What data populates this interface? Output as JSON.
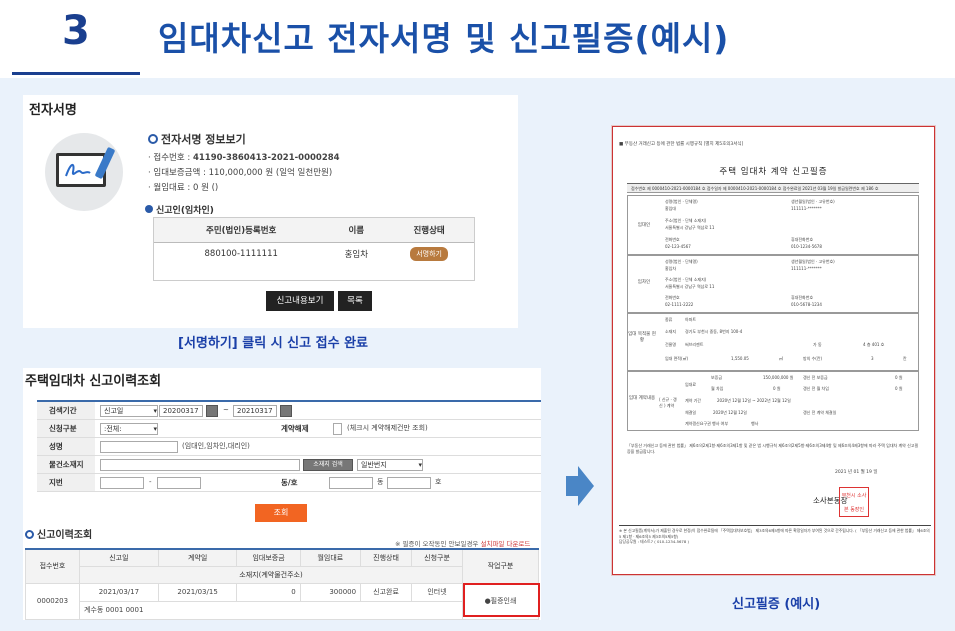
{
  "header": {
    "number": "3",
    "title": "임대차신고 전자서명 및 신고필증(예시)"
  },
  "sign_panel": {
    "title": "전자서명",
    "info_title": "전자서명 정보보기",
    "info_lines": [
      {
        "label": "· 접수번호 : ",
        "value": "41190-3860413-2021-0000284"
      },
      {
        "label": "· 임대보증금액 : ",
        "value": "110,000,000 원 (일억 일천만원)"
      },
      {
        "label": "· 월임대료 : ",
        "value": "0 원 ()"
      }
    ],
    "signer_title": "신고인(임차인)",
    "table": {
      "headers": [
        "주민(법인)등록번호",
        "이름",
        "진행상태"
      ],
      "row": {
        "id": "880100-1111111",
        "name": "홍임차",
        "status": "서명하기"
      }
    },
    "buttons": {
      "view": "신고내용보기",
      "list": "목록"
    },
    "caption": "[서명하기] 클릭 시 신고 접수 완료"
  },
  "history_panel": {
    "title": "주택임대차 신고이력조회",
    "form": {
      "period_label": "검색기간",
      "period_type": "신고일",
      "date_from": "20200317",
      "tilde": "~",
      "date_to": "20210317",
      "applicant_label": "신청구분",
      "applicant_value": ":전체:",
      "contract_label": "계약해제",
      "contract_check": "(체크시 계약해제건만 조회)",
      "name_label": "성명",
      "name_hint": "(임대인,임차인,대리인)",
      "address_label": "물건소재지",
      "address_btn": "소재지 검색",
      "address_type": "일반번지",
      "lot_label": "지번",
      "dash": "-",
      "dong_label": "동/호",
      "dong_unit": "동",
      "ho_unit": "호"
    },
    "search_button": "조회",
    "list_title": "신고이력조회",
    "note_prefix": "※ 필증이 오작동인 안보일경우 ",
    "note_link": "설치파일 다운로드",
    "table": {
      "headers": [
        "접수번호",
        "신고일",
        "계약일",
        "임대보증금",
        "월임대료",
        "진행상태",
        "신청구분",
        "작업구분"
      ],
      "subheader": "소재지(계약물건주소)",
      "row": {
        "receipt": "0000203",
        "report_date": "2021/03/17",
        "contract_date": "2021/03/15",
        "deposit": "0",
        "rent": "300000",
        "status": "신고완료",
        "type": "인터넷",
        "action": "필증인쇄",
        "address": "계수동 0001 0001"
      }
    }
  },
  "certificate": {
    "top_note": "■ 부동산 거래신고 등에 관한 법률 시행규칙 [별지 제5호의3서식]",
    "title": "주택 임대차 계약 신고필증",
    "bar": "접수번호  제 0000410-2021-0000184 호   접수일자  제 0000410-2021-0000184 호   접수완료일  2021년 03월 19일   발급일련번호  제 186 호",
    "lessor_label": "임대인",
    "lessee_label": "임차인",
    "property_label": "임대 목적물 현황",
    "contract_label": "임대 계약내용",
    "lessor": {
      "name_label": "성명(법인 · 단체명)",
      "name": "홍임대",
      "id_label": "생년월일(법인 · 고유번호)",
      "id": "111111-*******",
      "addr_label": "주소(법인 · 단체 소재지)",
      "addr": "서울특별시 강남구 역삼로 11",
      "tel_label": "전화번호",
      "tel": "02-123-4567",
      "mobile_label": "휴대전화번호",
      "mobile": "010-1234-5678"
    },
    "lessee": {
      "name_label": "성명(법인 · 단체명)",
      "name": "홍임차",
      "id_label": "생년월일(법인 · 고유번호)",
      "id": "111111-*******",
      "addr_label": "주소(법인 · 단체 소재지)",
      "addr": "서울특별시 강남구 역삼로 11",
      "tel_label": "전화번호",
      "tel": "02-1111-2222",
      "mobile_label": "휴대전화번호",
      "mobile": "010-5678-1234"
    },
    "property": {
      "kind_label": "종류",
      "kind": "아파트",
      "addr_label": "소재지",
      "addr": "경기도 부천시 중동, 8번지 100-4",
      "bldg_label": "건물명",
      "bldg": "써브리젠트",
      "dong": "가 동",
      "ho": "4 층  401 호",
      "area_label": "임대 면적(㎡)",
      "area": "1,550.05",
      "area_unit": "㎡",
      "rooms_label": "방의 수(칸)",
      "rooms": "3",
      "rooms_unit": "칸"
    },
    "contract": {
      "type_label": "( 신규 · 갱신 ) 계약",
      "fee_label": "임대료",
      "deposit_label": "보증금",
      "deposit": "150,000,000 원",
      "rent_label": "월 차임",
      "rent": "0 원",
      "prev_deposit_label": "갱신 전 보증금",
      "prev_deposit": "0 원",
      "prev_rent_label": "갱신 전 월 차임",
      "prev_rent": "0 원",
      "period_label": "계약 기간",
      "period": "2020년 12월 12일 ~ 2022년 12월 12일",
      "contract_date_label": "체결일",
      "contract_date": "2020년 12월 12일",
      "pre_renew_label": "갱신 전 계약 체결일",
      "right_label": "계약갱신요구권 행사 여부",
      "right": "행사"
    },
    "notice": "「부동산 거래신고 등에 관한 법률」 제6조의2제1항·제6조의3제1항 및 같은 법 시행규칙 제6조의2제5항·제6조의3제4항 및 제6조의4제3항에 따라 주택 임대차 계약 신고필증을 발급합니다.",
    "date": "2021 년  01 월  19 일",
    "signer": "소사본동장",
    "seal": "부천시 소사본 동장인",
    "footer": "※ 본 신고필증(계약서)가 제출된 경우로 한정(이 접수완료됨에 「주택임대차보호법」 제3조의6제5항에 따른 확정일자가 부여된 것으로 간주됩니다. ( 「부동산 거래신고 등에 관한 법률」 제6조의5 제1항 · 제6조의5 제3조의5제5항)",
    "issuer": "담당공무원 : 테스트7 ( 010-1234-5678 )"
  },
  "certificate_caption": "신고필증 (예시)"
}
